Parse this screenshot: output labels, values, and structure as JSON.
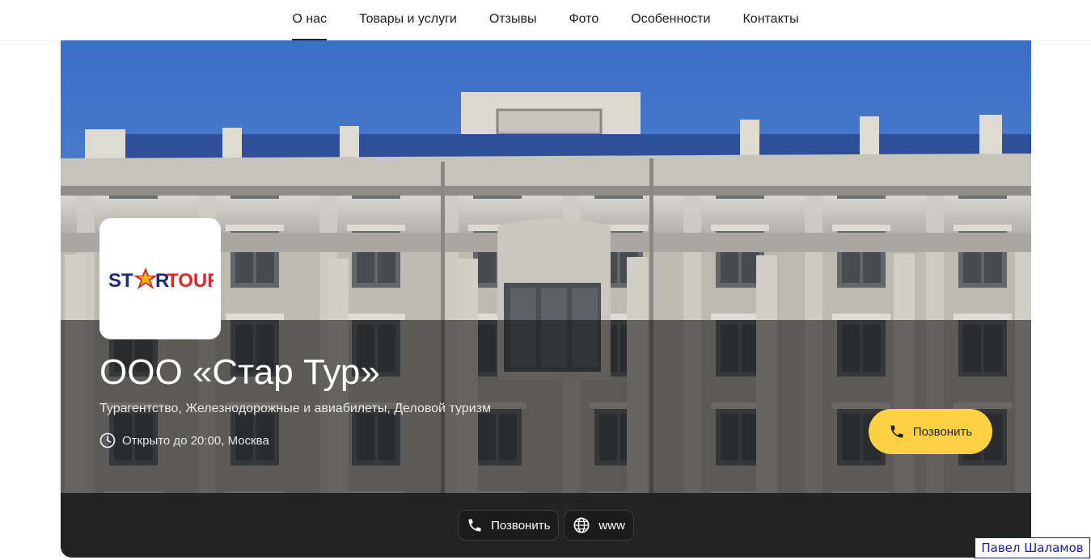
{
  "nav": {
    "items": [
      {
        "label": "О нас"
      },
      {
        "label": "Товары и услуги"
      },
      {
        "label": "Отзывы"
      },
      {
        "label": "Фото"
      },
      {
        "label": "Особенности"
      },
      {
        "label": "Контакты"
      }
    ],
    "active_index": 0
  },
  "company": {
    "logo": {
      "part1": "ST",
      "part2": "R",
      "part3": "TOUR"
    },
    "name": "ООО «Стар Тур»",
    "categories": "Турагентство, Железнодорожные и авиабилеты, Деловой туризм",
    "hours": "Открыто до 20:00, Москва"
  },
  "hero_actions": {
    "call_label": "Позвонить"
  },
  "bottom_actions": {
    "call_label": "Позвонить",
    "website_label": "www"
  },
  "watermark": {
    "author": "Павел Шаламов"
  },
  "colors": {
    "call_button": "#ffd244",
    "dark_panel": "#232323",
    "sky": "#3f73c9",
    "logo_blue": "#1f2b6e",
    "logo_red": "#e0262b"
  },
  "icons": {
    "clock": "clock-icon",
    "phone": "phone-icon",
    "globe": "globe-icon"
  }
}
